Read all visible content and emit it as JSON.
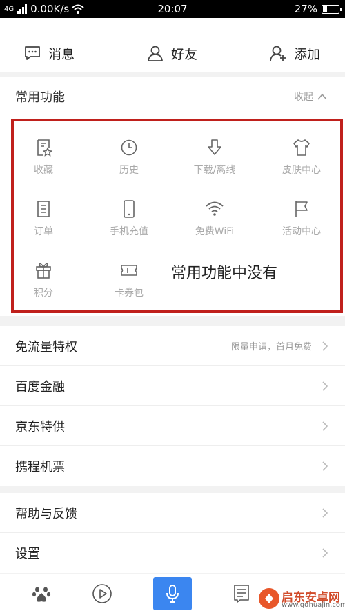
{
  "status_bar": {
    "signal": "4G",
    "network_speed": "0.00K/s",
    "time": "20:07",
    "battery": "27%",
    "battery_level": 0.27
  },
  "top_tabs": [
    {
      "label": "消息",
      "icon": "message-icon"
    },
    {
      "label": "好友",
      "icon": "friend-icon"
    },
    {
      "label": "添加",
      "icon": "add-friend-icon"
    }
  ],
  "common": {
    "title": "常用功能",
    "collapse_label": "收起",
    "items": [
      {
        "label": "收藏",
        "icon": "favorite-icon"
      },
      {
        "label": "历史",
        "icon": "clock-icon"
      },
      {
        "label": "下载/离线",
        "icon": "download-icon"
      },
      {
        "label": "皮肤中心",
        "icon": "shirt-icon"
      },
      {
        "label": "订单",
        "icon": "order-icon"
      },
      {
        "label": "手机充值",
        "icon": "phone-icon"
      },
      {
        "label": "免费WiFi",
        "icon": "wifi-icon"
      },
      {
        "label": "活动中心",
        "icon": "flag-icon"
      },
      {
        "label": "积分",
        "icon": "gift-icon"
      },
      {
        "label": "卡券包",
        "icon": "ticket-icon"
      }
    ],
    "annotation": "常用功能中没有"
  },
  "menu_group_1": [
    {
      "label": "免流量特权",
      "hint": "限量申请，首月免费"
    },
    {
      "label": "百度金融",
      "hint": ""
    },
    {
      "label": "京东特供",
      "hint": ""
    },
    {
      "label": "携程机票",
      "hint": ""
    }
  ],
  "menu_group_2": [
    {
      "label": "帮助与反馈",
      "hint": ""
    },
    {
      "label": "设置",
      "hint": ""
    }
  ],
  "bottom_nav": [
    {
      "name": "baidu-paw-icon"
    },
    {
      "name": "video-play-icon"
    },
    {
      "name": "microphone-icon"
    },
    {
      "name": "feed-icon"
    }
  ],
  "watermark": {
    "title": "启东安卓网",
    "url": "www.qdhuajin.com"
  },
  "colors": {
    "accent": "#3b86f0",
    "highlight_frame": "#c0201c",
    "muted_text": "#aaaaaa"
  }
}
